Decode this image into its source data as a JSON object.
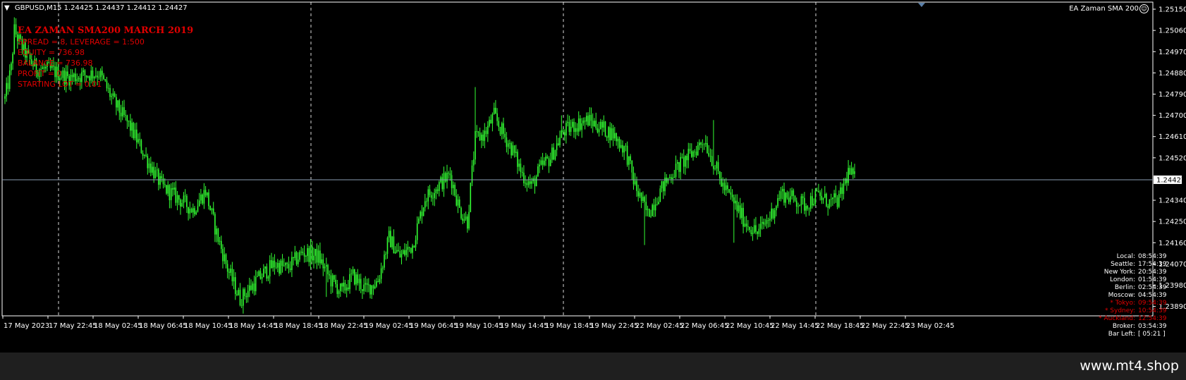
{
  "chart": {
    "header": "GBPUSD,M15  1.24425 1.24437 1.24412 1.24427",
    "ea_name": "EA Zaman SMA 200",
    "smiley_glyph": "☺",
    "current_price_label": "1.24427",
    "colors": {
      "candles": "#33ff33",
      "info_text": "#e00000",
      "axis": "#ffffff",
      "grid": "#ffffff",
      "background": "#000000"
    }
  },
  "ea_info": {
    "title": "EA ZAMAN SMA200 MARCH 2019",
    "lines": [
      "SPREAD = 8, LEVERAGE = 1:500",
      "EQUITY = 736.98",
      "BALANCE = 736.98",
      "PROFIT = 0",
      "STARTING LOT = 0.01"
    ]
  },
  "clock": [
    {
      "city": "Local:",
      "time": "08:54:39",
      "red": false
    },
    {
      "city": "Seattle:",
      "time": "17:54:39",
      "red": false
    },
    {
      "city": "New York:",
      "time": "20:54:39",
      "red": false
    },
    {
      "city": "London:",
      "time": "01:54:39",
      "red": false
    },
    {
      "city": "Berlin:",
      "time": "02:54:39",
      "red": false
    },
    {
      "city": "Moscow:",
      "time": "04:54:39",
      "red": false
    },
    {
      "city": "* Tokyo:",
      "time": "09:54:39",
      "red": true
    },
    {
      "city": "* Sydney:",
      "time": "10:54:39",
      "red": true
    },
    {
      "city": "* Auckland:",
      "time": "12:54:39",
      "red": true
    },
    {
      "city": "Broker:",
      "time": "03:54:39",
      "red": false
    },
    {
      "city": "Bar Left:",
      "time": "[ 05:21 ]",
      "red": false
    }
  ],
  "chart_data": {
    "type": "candlestick",
    "y_ticks": [
      "1.25150",
      "1.25060",
      "1.24970",
      "1.24880",
      "1.24790",
      "1.24700",
      "1.24610",
      "1.24520",
      "1.24340",
      "1.24250",
      "1.24160",
      "1.24070",
      "1.23980",
      "1.23890"
    ],
    "ylim": [
      1.2385,
      1.2518
    ],
    "x_ticks": [
      "17 May 2023",
      "17 May 22:45",
      "18 May 02:45",
      "18 May 06:45",
      "18 May 10:45",
      "18 May 14:45",
      "18 May 18:45",
      "18 May 22:45",
      "19 May 02:45",
      "19 May 06:45",
      "19 May 10:45",
      "19 May 14:45",
      "19 May 18:45",
      "19 May 22:45",
      "22 May 02:45",
      "22 May 06:45",
      "22 May 10:45",
      "22 May 14:45",
      "22 May 18:45",
      "22 May 22:45",
      "23 May 02:45"
    ],
    "current_price": 1.24427,
    "close_anchors": [
      [
        0,
        1.2477
      ],
      [
        4,
        1.249
      ],
      [
        6,
        1.2506
      ],
      [
        10,
        1.25
      ],
      [
        15,
        1.2494
      ],
      [
        20,
        1.249
      ],
      [
        30,
        1.2489
      ],
      [
        40,
        1.2486
      ],
      [
        50,
        1.2487
      ],
      [
        60,
        1.2488
      ],
      [
        70,
        1.2475
      ],
      [
        80,
        1.2465
      ],
      [
        90,
        1.2452
      ],
      [
        100,
        1.244
      ],
      [
        110,
        1.2435
      ],
      [
        120,
        1.243
      ],
      [
        128,
        1.2438
      ],
      [
        135,
        1.242
      ],
      [
        142,
        1.2405
      ],
      [
        150,
        1.2392
      ],
      [
        158,
        1.2398
      ],
      [
        165,
        1.2403
      ],
      [
        172,
        1.2407
      ],
      [
        180,
        1.2405
      ],
      [
        190,
        1.2412
      ],
      [
        200,
        1.241
      ],
      [
        208,
        1.24
      ],
      [
        215,
        1.2395
      ],
      [
        222,
        1.2402
      ],
      [
        230,
        1.2396
      ],
      [
        238,
        1.24
      ],
      [
        245,
        1.2418
      ],
      [
        252,
        1.241
      ],
      [
        260,
        1.2415
      ],
      [
        268,
        1.2435
      ],
      [
        276,
        1.244
      ],
      [
        284,
        1.2445
      ],
      [
        290,
        1.243
      ],
      [
        295,
        1.2425
      ],
      [
        300,
        1.246
      ],
      [
        306,
        1.2462
      ],
      [
        312,
        1.247
      ],
      [
        318,
        1.2462
      ],
      [
        324,
        1.2455
      ],
      [
        330,
        1.2445
      ],
      [
        336,
        1.244
      ],
      [
        342,
        1.2448
      ],
      [
        348,
        1.2452
      ],
      [
        356,
        1.2463
      ],
      [
        364,
        1.2466
      ],
      [
        372,
        1.2468
      ],
      [
        380,
        1.2465
      ],
      [
        388,
        1.2462
      ],
      [
        396,
        1.2455
      ],
      [
        402,
        1.244
      ],
      [
        410,
        1.2428
      ],
      [
        418,
        1.2438
      ],
      [
        425,
        1.2445
      ],
      [
        432,
        1.245
      ],
      [
        440,
        1.2455
      ],
      [
        446,
        1.246
      ],
      [
        452,
        1.245
      ],
      [
        458,
        1.244
      ],
      [
        465,
        1.2433
      ],
      [
        472,
        1.2425
      ],
      [
        480,
        1.242
      ],
      [
        488,
        1.2427
      ],
      [
        495,
        1.2437
      ],
      [
        502,
        1.2435
      ],
      [
        510,
        1.2432
      ],
      [
        518,
        1.2436
      ],
      [
        526,
        1.2433
      ],
      [
        532,
        1.2434
      ],
      [
        538,
        1.2446
      ],
      [
        542,
        1.2443
      ]
    ],
    "high_spikes": [
      [
        300,
        1.2482
      ],
      [
        452,
        1.2468
      ],
      [
        355,
        1.247
      ]
    ],
    "low_spikes": [
      [
        150,
        1.2389
      ],
      [
        205,
        1.2393
      ],
      [
        408,
        1.2415
      ],
      [
        465,
        1.2416
      ]
    ]
  },
  "footer": {
    "site": "www.mt4.shop"
  }
}
